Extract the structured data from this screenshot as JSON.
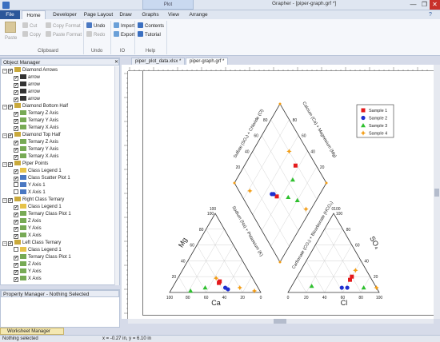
{
  "titlebar": {
    "context_tab": "Plot",
    "title": "Grapher - [piper-graph.grf *]",
    "minimize": "—",
    "restore": "❐",
    "close": "✕"
  },
  "tabs": [
    "File",
    "Home",
    "Developer",
    "Page Layout",
    "Draw",
    "Graphs",
    "View",
    "Arrange"
  ],
  "ribbon": {
    "clipboard": {
      "paste": "Paste",
      "cut": "Cut",
      "copy": "Copy",
      "copy_format": "Copy Format",
      "paste_format": "Paste Format",
      "group": "Clipboard"
    },
    "undo": {
      "undo": "Undo",
      "redo": "Redo",
      "group": "Undo"
    },
    "io": {
      "import": "Import",
      "export": "Export",
      "group": "IO"
    },
    "help": {
      "contents": "Contents",
      "tutorial": "Tutorial",
      "group": "Help"
    }
  },
  "object_manager": {
    "title": "Object Manager",
    "items": [
      {
        "label": "Diamond Arrows",
        "level": 0,
        "checked": true,
        "icon": "group"
      },
      {
        "label": "arrow",
        "level": 1,
        "checked": true,
        "icon": "arrow"
      },
      {
        "label": "arrow",
        "level": 1,
        "checked": true,
        "icon": "arrow"
      },
      {
        "label": "arrow",
        "level": 1,
        "checked": true,
        "icon": "arrow"
      },
      {
        "label": "arrow",
        "level": 1,
        "checked": true,
        "icon": "arrow"
      },
      {
        "label": "Diamond Bottom Half",
        "level": 0,
        "checked": true,
        "icon": "group"
      },
      {
        "label": "Ternary Z Axis",
        "level": 1,
        "checked": true,
        "icon": "axis"
      },
      {
        "label": "Ternary Y Axis",
        "level": 1,
        "checked": true,
        "icon": "axis"
      },
      {
        "label": "Ternary X Axis",
        "level": 1,
        "checked": true,
        "icon": "axis"
      },
      {
        "label": "Diamond Top Half",
        "level": 0,
        "checked": true,
        "icon": "group"
      },
      {
        "label": "Ternary Z Axis",
        "level": 1,
        "checked": true,
        "icon": "axis"
      },
      {
        "label": "Ternary Y Axis",
        "level": 1,
        "checked": true,
        "icon": "axis"
      },
      {
        "label": "Ternary X Axis",
        "level": 1,
        "checked": true,
        "icon": "axis"
      },
      {
        "label": "Piper Points",
        "level": 0,
        "checked": true,
        "icon": "group"
      },
      {
        "label": "Class Legend 1",
        "level": 1,
        "checked": true,
        "icon": "legend"
      },
      {
        "label": "Class Scatter Plot 1",
        "level": 1,
        "checked": true,
        "icon": "scatter"
      },
      {
        "label": "Y Axis 1",
        "level": 1,
        "checked": false,
        "icon": "yaxis"
      },
      {
        "label": "X Axis 1",
        "level": 1,
        "checked": false,
        "icon": "xaxis"
      },
      {
        "label": "Right Class Ternary",
        "level": 0,
        "checked": true,
        "icon": "group"
      },
      {
        "label": "Class Legend 1",
        "level": 1,
        "checked": true,
        "icon": "legend"
      },
      {
        "label": "Ternary Class Plot 1",
        "level": 1,
        "checked": true,
        "icon": "ternary"
      },
      {
        "label": "Z Axis",
        "level": 1,
        "checked": true,
        "icon": "axis"
      },
      {
        "label": "Y Axis",
        "level": 1,
        "checked": true,
        "icon": "axis"
      },
      {
        "label": "X Axis",
        "level": 1,
        "checked": true,
        "icon": "axis"
      },
      {
        "label": "Left Class Ternary",
        "level": 0,
        "checked": true,
        "icon": "group"
      },
      {
        "label": "Class Legend 1",
        "level": 1,
        "checked": false,
        "icon": "legend"
      },
      {
        "label": "Ternary Class Plot 1",
        "level": 1,
        "checked": true,
        "icon": "ternary"
      },
      {
        "label": "Z Axis",
        "level": 1,
        "checked": true,
        "icon": "axis"
      },
      {
        "label": "Y Axis",
        "level": 1,
        "checked": true,
        "icon": "axis"
      },
      {
        "label": "X Axis",
        "level": 1,
        "checked": true,
        "icon": "axis"
      }
    ]
  },
  "property_manager": {
    "title": "Property Manager - Nothing Selected"
  },
  "doc_tabs": [
    "piper_plot_data.xlsx *",
    "piper-graph.grf *"
  ],
  "worksheet_manager": "Worksheet Manager",
  "status": {
    "left": "Nothing selected",
    "coords": "x = -0.27 in, y = 6.10 in"
  },
  "chart_data": {
    "type": "scatter",
    "legend": [
      "Sample 1",
      "Sample 2",
      "Sample 3",
      "Sample 4"
    ],
    "colors": [
      "#e41a1c",
      "#1f2fd0",
      "#2ec02e",
      "#f39c12"
    ],
    "left_ternary": {
      "apex_label": "Mg",
      "bottom_label": "Ca",
      "left_ticks": [
        "20",
        "40",
        "60",
        "80",
        "100"
      ],
      "bottom_ticks": [
        "100",
        "80",
        "60",
        "40",
        "20",
        "0"
      ],
      "top_tick": "100"
    },
    "right_ternary": {
      "apex_label": "SO₄",
      "bottom_label": "Cl",
      "right_ticks": [
        "20",
        "40",
        "60",
        "80",
        "100"
      ],
      "bottom_ticks": [
        "0",
        "20",
        "40",
        "60",
        "80",
        "100"
      ],
      "top_tick": "0100"
    },
    "diamond": {
      "upper_left_label": "Sulfate (SO₄) + Chloride (Cl)",
      "upper_right_label": "Calcium (Ca) + Magnesium (Mg)",
      "lower_left_label": "Sodium (Na) + Potassium (K)",
      "lower_right_label": "Carbonate (CO₃) + Bicarbonate (HCO₃)",
      "left_ticks": [
        "20",
        "40",
        "60",
        "80"
      ],
      "right_ticks": [
        "80",
        "60",
        "40",
        "20"
      ]
    },
    "points": {
      "left_ternary": [
        {
          "series": 1,
          "ca": 38,
          "mg": 14
        },
        {
          "series": 1,
          "ca": 40,
          "mg": 12
        },
        {
          "series": 2,
          "ca": 36,
          "mg": 6
        },
        {
          "series": 2,
          "ca": 34,
          "mg": 4
        },
        {
          "series": 3,
          "ca": 58,
          "mg": 6
        },
        {
          "series": 3,
          "ca": 76,
          "mg": 2
        },
        {
          "series": 4,
          "ca": 40,
          "mg": 18
        },
        {
          "series": 4,
          "ca": 20,
          "mg": 6
        },
        {
          "series": 4,
          "ca": 6,
          "mg": 2
        }
      ],
      "right_ternary": [
        {
          "series": 1,
          "cl": 60,
          "so4": 16
        },
        {
          "series": 1,
          "cl": 60,
          "so4": 20
        },
        {
          "series": 2,
          "cl": 56,
          "so4": 6
        },
        {
          "series": 2,
          "cl": 62,
          "so4": 6
        },
        {
          "series": 3,
          "cl": 80,
          "so4": 6
        },
        {
          "series": 3,
          "cl": 22,
          "so4": 8
        },
        {
          "series": 4,
          "cl": 60,
          "so4": 28
        },
        {
          "series": 4,
          "cl": 94,
          "so4": 6
        }
      ],
      "diamond": [
        {
          "series": 1,
          "u": 0.78,
          "v": 0.56
        },
        {
          "series": 1,
          "u": 0.38,
          "v": 0.55
        },
        {
          "series": 2,
          "u": 0.34,
          "v": 0.48
        },
        {
          "series": 2,
          "u": 0.36,
          "v": 0.5
        },
        {
          "series": 3,
          "u": 0.58,
          "v": 0.8
        },
        {
          "series": 3,
          "u": 0.66,
          "v": 0.62
        },
        {
          "series": 3,
          "u": 0.5,
          "v": 0.68
        },
        {
          "series": 4,
          "u": 0.8,
          "v": 0.4
        },
        {
          "series": 4,
          "u": 0.62,
          "v": 0.95
        },
        {
          "series": 4,
          "u": 0.12,
          "v": 0.22
        }
      ]
    }
  }
}
